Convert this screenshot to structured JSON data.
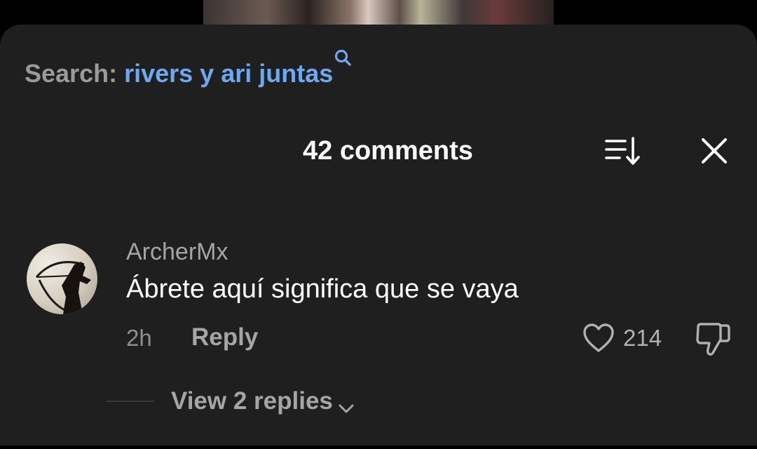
{
  "search": {
    "prefix": "Search:",
    "term": "rivers y ari juntas"
  },
  "header": {
    "comment_count": "42 comments"
  },
  "comment": {
    "username": "ArcherMx",
    "text": "Ábrete aquí significa que se vaya",
    "timestamp": "2h",
    "reply_label": "Reply",
    "like_count": "214",
    "view_replies_label": "View 2 replies"
  },
  "icons": {
    "search": "search-icon",
    "sort": "sort-icon",
    "close": "close-icon",
    "like": "heart-icon",
    "dislike": "thumbs-down-icon",
    "expand": "chevron-down-icon"
  },
  "colors": {
    "sheet_background": "#1f1f1f",
    "search_term": "#6fa8f0",
    "primary_text": "#ffffff",
    "secondary_text": "#a5a5a5"
  }
}
